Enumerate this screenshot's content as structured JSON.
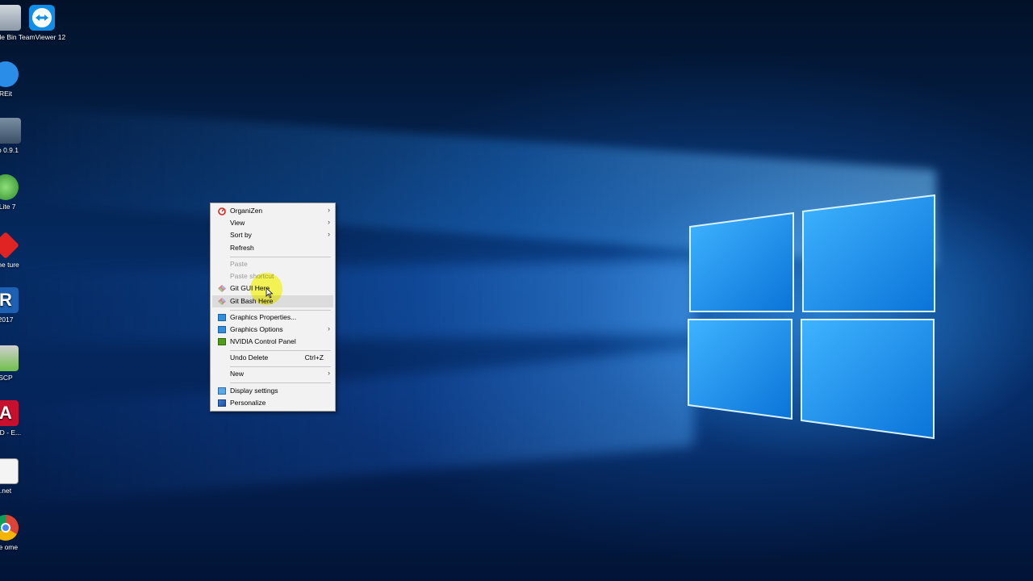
{
  "desktop": {
    "icons": [
      {
        "label": "le Bin",
        "icon": "recycle-bin-icon"
      },
      {
        "label": "TeamViewer 12",
        "icon": "teamviewer-icon"
      },
      {
        "label": "REit",
        "icon": "app-icon"
      },
      {
        "label": "o 0.9.1",
        "icon": "app-icon"
      },
      {
        "label": "l Lite 7",
        "icon": "app-icon"
      },
      {
        "label": "tone ture",
        "icon": "app-icon"
      },
      {
        "label": "2017",
        "icon": "app-icon"
      },
      {
        "label": "SCP",
        "icon": "winscp-icon"
      },
      {
        "label": "CAD - E...",
        "icon": "autocad-icon"
      },
      {
        "label": ".net",
        "icon": "app-icon"
      },
      {
        "label": "gle ome",
        "icon": "chrome-icon"
      }
    ]
  },
  "context_menu": {
    "items": [
      {
        "label": "OrganiZen",
        "icon": "organizen-icon",
        "submenu": true
      },
      {
        "label": "View",
        "submenu": true
      },
      {
        "label": "Sort by",
        "submenu": true
      },
      {
        "label": "Refresh"
      },
      {
        "label": "Paste",
        "disabled": true
      },
      {
        "label": "Paste shortcut",
        "disabled": true
      },
      {
        "label": "Git GUI Here",
        "icon": "git-icon"
      },
      {
        "label": "Git Bash Here",
        "icon": "git-icon",
        "highlighted": true
      },
      {
        "label": "Graphics Properties...",
        "icon": "intel-graphics-icon"
      },
      {
        "label": "Graphics Options",
        "icon": "intel-graphics-icon",
        "submenu": true
      },
      {
        "label": "NVIDIA Control Panel",
        "icon": "nvidia-icon"
      },
      {
        "label": "Undo Delete",
        "shortcut": "Ctrl+Z"
      },
      {
        "label": "New",
        "submenu": true
      },
      {
        "label": "Display settings",
        "icon": "display-icon"
      },
      {
        "label": "Personalize",
        "icon": "personalize-icon"
      }
    ],
    "arrow_glyph": "›"
  },
  "colors": {
    "menu_bg": "#f2f2f2",
    "menu_highlight": "#dcdcdc",
    "cursor_highlight": "#ffff3c"
  }
}
